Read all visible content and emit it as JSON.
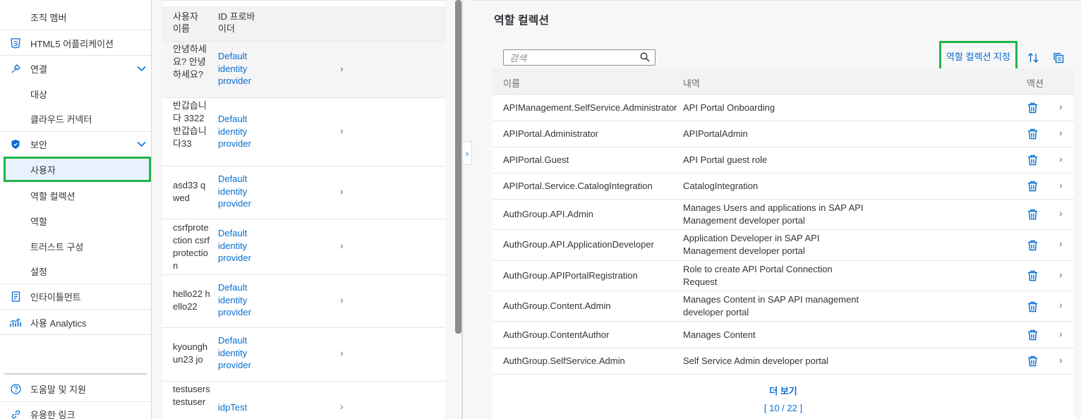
{
  "sidebar": {
    "org_members": "조직 멤버",
    "html5_apps": "HTML5 어플리케이션",
    "connectivity": "연결",
    "destinations": "대상",
    "cloud_connectors": "클라우드 커넥터",
    "security": "보안",
    "users": "사용자",
    "role_collections": "역할 컬렉션",
    "roles": "역할",
    "trust_config": "트러스트 구성",
    "settings": "설정",
    "entitlements": "인타이틀먼트",
    "usage_analytics": "사용 Analytics",
    "help_support": "도움말 및 지원",
    "useful_links": "유용한 링크"
  },
  "user_list": {
    "header_name": "사용자 이름",
    "header_idp": "ID 프로바이더",
    "rows": [
      {
        "name": "안녕하세요? 안녕하세요?",
        "idp": "Default identity provider"
      },
      {
        "name": "반갑습니다 3322 반갑습니다33",
        "idp": "Default identity provider"
      },
      {
        "name": "asd33 qwed",
        "idp": "Default identity provider"
      },
      {
        "name": "csrfprotection csrfprotection",
        "idp": "Default identity provider"
      },
      {
        "name": "hello22 hello22",
        "idp": "Default identity provider"
      },
      {
        "name": "kyounghun23 jo",
        "idp": "Default identity provider"
      },
      {
        "name": "testusers testuser",
        "idp": "idpTest"
      }
    ]
  },
  "role_collections": {
    "title": "역할 컬렉션",
    "search_placeholder": "검색",
    "assign_button": "역할 컬렉션 지정",
    "col_name": "이름",
    "col_description": "내역",
    "col_actions": "액션",
    "rows": [
      {
        "name": "APIManagement.SelfService.Administrator",
        "description": "API Portal Onboarding"
      },
      {
        "name": "APIPortal.Administrator",
        "description": "APIPortalAdmin"
      },
      {
        "name": "APIPortal.Guest",
        "description": "API Portal guest role"
      },
      {
        "name": "APIPortal.Service.CatalogIntegration",
        "description": "CatalogIntegration"
      },
      {
        "name": "AuthGroup.API.Admin",
        "description": "Manages Users and applications in SAP API Management developer portal"
      },
      {
        "name": "AuthGroup.API.ApplicationDeveloper",
        "description": "Application Developer in SAP API Management developer portal"
      },
      {
        "name": "AuthGroup.APIPortalRegistration",
        "description": "Role to create API Portal Connection Request"
      },
      {
        "name": "AuthGroup.Content.Admin",
        "description": "Manages Content in SAP API management developer portal"
      },
      {
        "name": "AuthGroup.ContentAuthor",
        "description": "Manages Content"
      },
      {
        "name": "AuthGroup.SelfService.Admin",
        "description": "Self Service Admin developer portal"
      }
    ],
    "more_button": "더 보기",
    "count_label": "[ 10 / 22 ]"
  },
  "icons": {
    "html5": "html5-icon",
    "connectivity": "plug-icon",
    "security": "shield-icon",
    "entitlements": "entitlement-icon",
    "analytics": "chart-icon",
    "help": "help-icon",
    "links": "link-icon",
    "search": "search-icon",
    "sort": "sort-icon",
    "copy": "copy-icon",
    "delete": "trash-icon",
    "chevron": "chevron-right-icon"
  },
  "colors": {
    "accent": "#0a6ed1",
    "highlight": "#1fb54a"
  }
}
